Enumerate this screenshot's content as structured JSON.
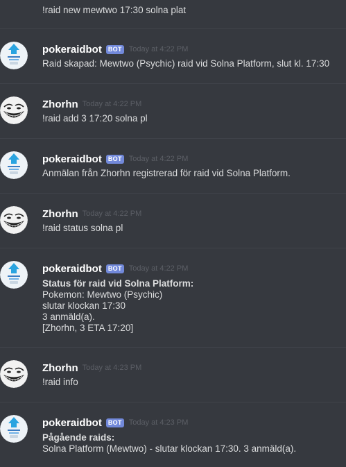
{
  "top_message": "!raid new mewtwo 17:30 solna plat",
  "messages": [
    {
      "author": "pokeraidbot",
      "bot_tag": "BOT",
      "timestamp": "Today at 4:22 PM",
      "text": "Raid skapad: Mewtwo (Psychic) raid vid Solna Platform, slut kl. 17:30"
    },
    {
      "author": "Zhorhn",
      "timestamp": "Today at 4:22 PM",
      "text": "!raid add 3 17:20 solna pl"
    },
    {
      "author": "pokeraidbot",
      "bot_tag": "BOT",
      "timestamp": "Today at 4:22 PM",
      "text": "Anmälan från Zhorhn registrerad för raid vid Solna Platform."
    },
    {
      "author": "Zhorhn",
      "timestamp": "Today at 4:22 PM",
      "text": "!raid status solna pl"
    },
    {
      "author": "pokeraidbot",
      "bot_tag": "BOT",
      "timestamp": "Today at 4:22 PM",
      "bold_line": "Status för raid vid Solna Platform:",
      "lines": [
        "Pokemon: Mewtwo (Psychic)",
        "slutar klockan 17:30",
        "3 anmäld(a).",
        "[Zhorhn, 3 ETA 17:20]"
      ]
    },
    {
      "author": "Zhorhn",
      "timestamp": "Today at 4:23 PM",
      "text": "!raid info"
    },
    {
      "author": "pokeraidbot",
      "bot_tag": "BOT",
      "timestamp": "Today at 4:23 PM",
      "bold_line": "Pågående raids:",
      "lines": [
        "Solna Platform (Mewtwo) - slutar klockan 17:30. 3 anmäld(a)."
      ]
    }
  ],
  "colors": {
    "background": "#36393f",
    "divider": "#40434a",
    "username": "#ffffff",
    "bot_tag_bg": "#7289da",
    "timestamp": "#5c5f66",
    "message_text": "#dcddde"
  },
  "icons": {
    "bot_avatar": "pokeraidbot-avatar-icon",
    "user_avatar": "trollface-avatar-icon"
  }
}
